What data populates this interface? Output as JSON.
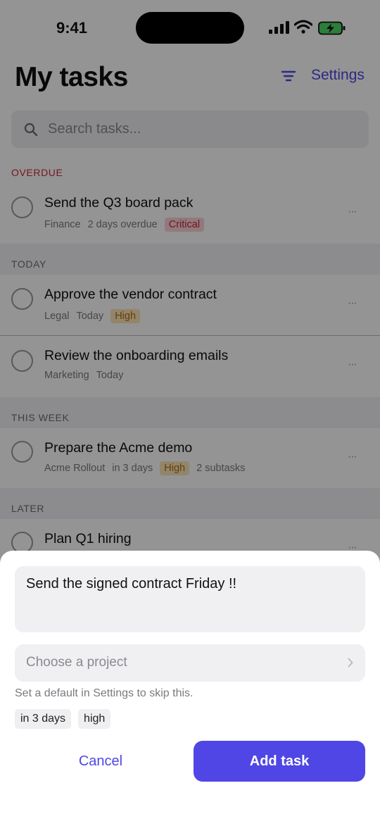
{
  "status_bar": {
    "time": "9:41"
  },
  "header": {
    "title": "My tasks",
    "settings_label": "Settings"
  },
  "search": {
    "placeholder": "Search tasks..."
  },
  "sections": {
    "overdue": "OVERDUE",
    "today": "TODAY",
    "this_week": "THIS WEEK",
    "later": "LATER"
  },
  "tasks": [
    {
      "title": "Send the Q3 board pack",
      "project": "Finance",
      "due": "2 days overdue",
      "priority": "Critical"
    },
    {
      "title": "Approve the vendor contract",
      "project": "Legal",
      "due": "Today",
      "priority": "High"
    },
    {
      "title": "Review the onboarding emails",
      "project": "Marketing",
      "due": "Today"
    },
    {
      "title": "Prepare the Acme demo",
      "project": "Acme Rollout",
      "due": "in 3 days",
      "priority": "High",
      "subtasks": "2 subtasks"
    },
    {
      "title": "Plan Q1 hiring"
    }
  ],
  "more_label": "···",
  "sheet": {
    "input_value": "Send the signed contract Friday !!",
    "project_placeholder": "Choose a project",
    "hint": "Set a default in Settings to skip this.",
    "chips": [
      "in 3 days",
      "high"
    ],
    "cancel_label": "Cancel",
    "add_label": "Add task"
  },
  "colors": {
    "accent": "#4f46e5",
    "overdue": "#c6283a",
    "critical_bg": "#fbd3d6",
    "high_bg": "#fbe6b8"
  }
}
